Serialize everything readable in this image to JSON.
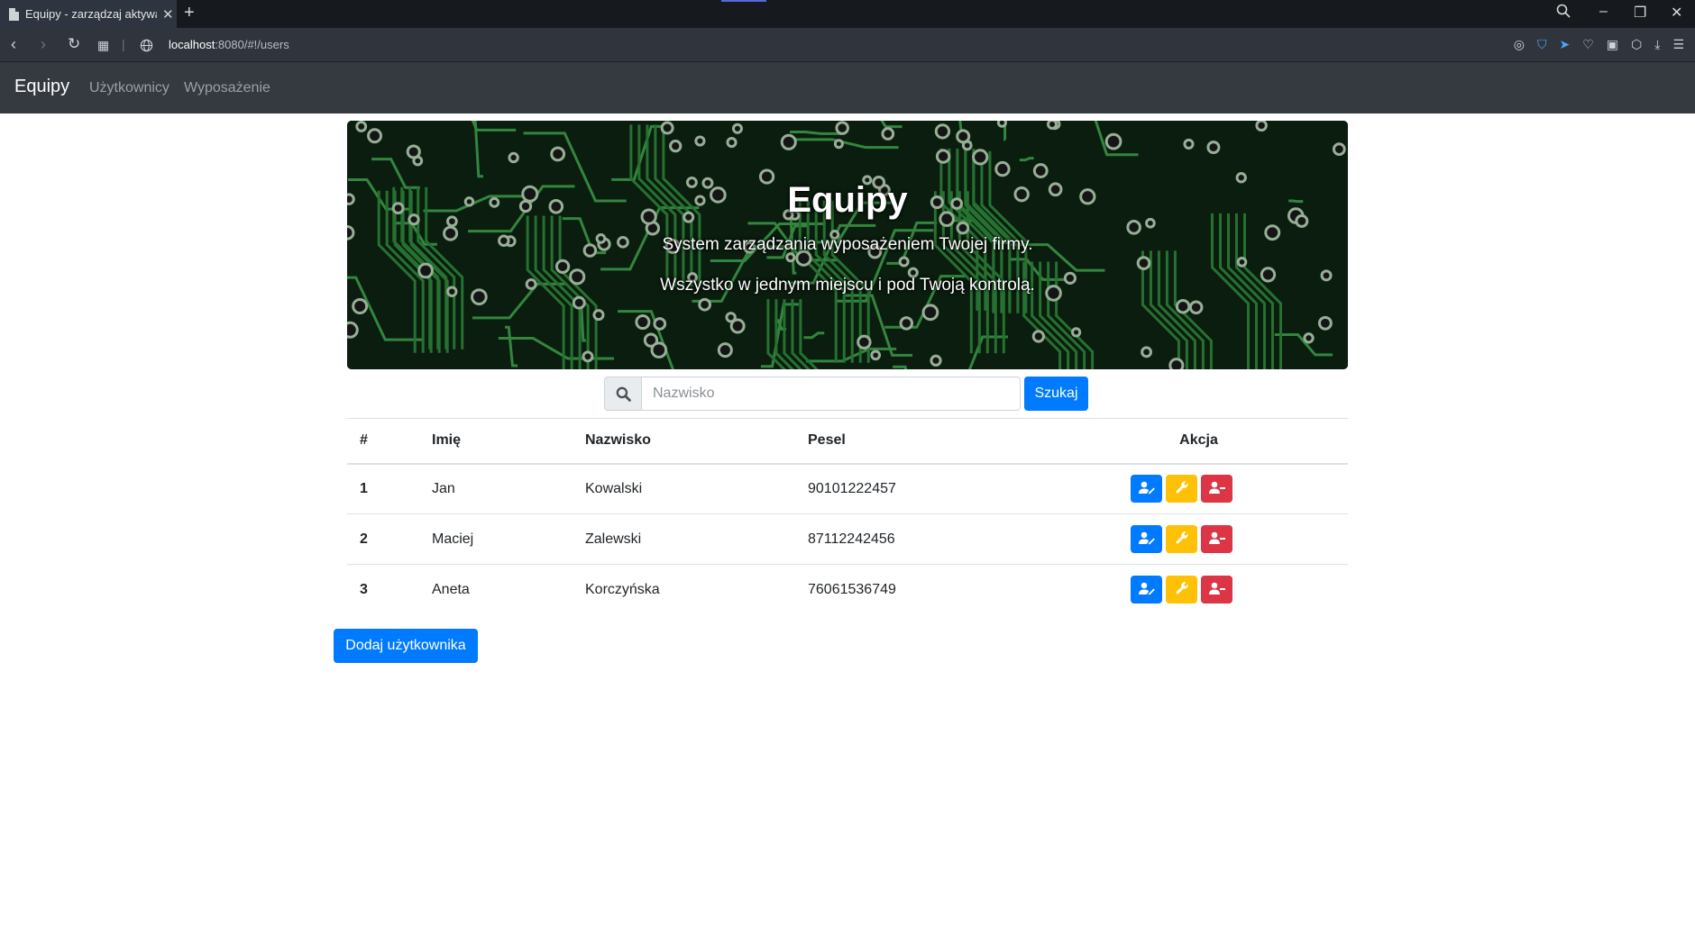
{
  "browser": {
    "tab_title": "Equipy - zarządzaj aktywami",
    "url_host": "localhost",
    "url_rest": ":8080/#!/users"
  },
  "navbar": {
    "brand": "Equipy",
    "links": [
      "Użytkownicy",
      "Wyposażenie"
    ]
  },
  "hero": {
    "title": "Equipy",
    "line1": "System zarządzania wyposażeniem Twojej firmy.",
    "line2": "Wszystko w jednym miejscu i pod Twoją kontrolą."
  },
  "search": {
    "placeholder": "Nazwisko",
    "button": "Szukaj"
  },
  "table": {
    "headers": [
      "#",
      "Imię",
      "Nazwisko",
      "Pesel",
      "Akcja"
    ],
    "rows": [
      {
        "id": "1",
        "first": "Jan",
        "last": "Kowalski",
        "pesel": "90101222457"
      },
      {
        "id": "2",
        "first": "Maciej",
        "last": "Zalewski",
        "pesel": "87112242456"
      },
      {
        "id": "3",
        "first": "Aneta",
        "last": "Korczyńska",
        "pesel": "76061536749"
      }
    ],
    "action_icons": [
      "user-edit-icon",
      "wrench-icon",
      "user-minus-icon"
    ]
  },
  "add_button": "Dodaj użytkownika",
  "colors": {
    "primary": "#007bff",
    "warning": "#ffc107",
    "danger": "#dc3545",
    "navbar": "#343a40"
  }
}
